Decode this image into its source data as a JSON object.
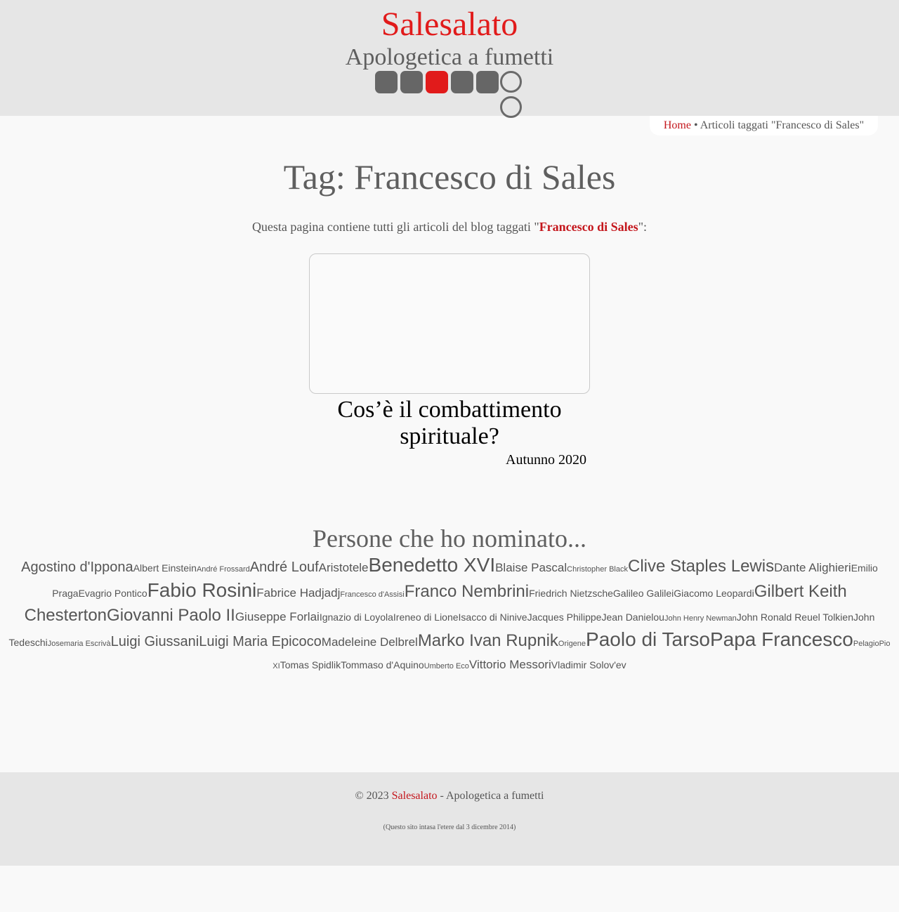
{
  "header": {
    "site_title": "Salesalato",
    "site_subtitle": "Apologetica a fumetti"
  },
  "breadcrumb": {
    "home": "Home",
    "separator": "•",
    "current": "Articoli taggati \"Francesco di Sales\""
  },
  "main": {
    "page_title": "Tag: Francesco di Sales",
    "intro_before": "Questa pagina contiene tutti gli articoli del blog taggati \"",
    "intro_tag": "Francesco di Sales",
    "intro_after": "\":",
    "post": {
      "title": "Cos’è il combattimento spirituale?",
      "date": "Autunno 2020"
    }
  },
  "people": {
    "title": "Persone che ho nominato...",
    "tags": [
      "Agostino d'Ippona",
      "Albert Einstein",
      "André Frossard",
      "André Louf",
      "Aristotele",
      "Benedetto XVI",
      "Blaise Pascal",
      "Christopher Black",
      "Clive Staples Lewis",
      "Dante Alighieri",
      "Emilio Praga",
      "Evagrio Pontico",
      "Fabio Rosini",
      "Fabrice Hadjadj",
      "Francesco d'Assisi",
      "Franco Nembrini",
      "Friedrich Nietzsche",
      "Galileo Galilei",
      "Giacomo Leopardi",
      "Gilbert Keith Chesterton",
      "Giovanni Paolo II",
      "Giuseppe Forlai",
      "Ignazio di Loyola",
      "Ireneo di Lione",
      "Isacco di Ninive",
      "Jacques Philippe",
      "Jean Danielou",
      "John Henry Newman",
      "John Ronald Reuel Tolkien",
      "John Tedeschi",
      "Josemaria Escrivà",
      "Luigi Giussani",
      "Luigi Maria Epicoco",
      "Madeleine Delbrel",
      "Marko Ivan Rupnik",
      "Origene",
      "Paolo di Tarso",
      "Papa Francesco",
      "Pelagio",
      "Pio XI",
      "Tomas Spidlik",
      "Tommaso d'Aquino",
      "Umberto Eco",
      "Vittorio Messori",
      "Vladimir Solov'ev"
    ]
  },
  "footer": {
    "copyright_prefix": "© 2023 ",
    "site_link": "Salesalato",
    "copyright_suffix": " - Apologetica a fumetti",
    "since": "(Questo sito intasa l'etere dal 3 dicembre 2014)"
  },
  "colors": {
    "accent": "#e11b1b",
    "link": "#c4161c",
    "header_bg": "#e6e6e6",
    "page_bg": "#f9f9f9",
    "text": "#555555"
  }
}
